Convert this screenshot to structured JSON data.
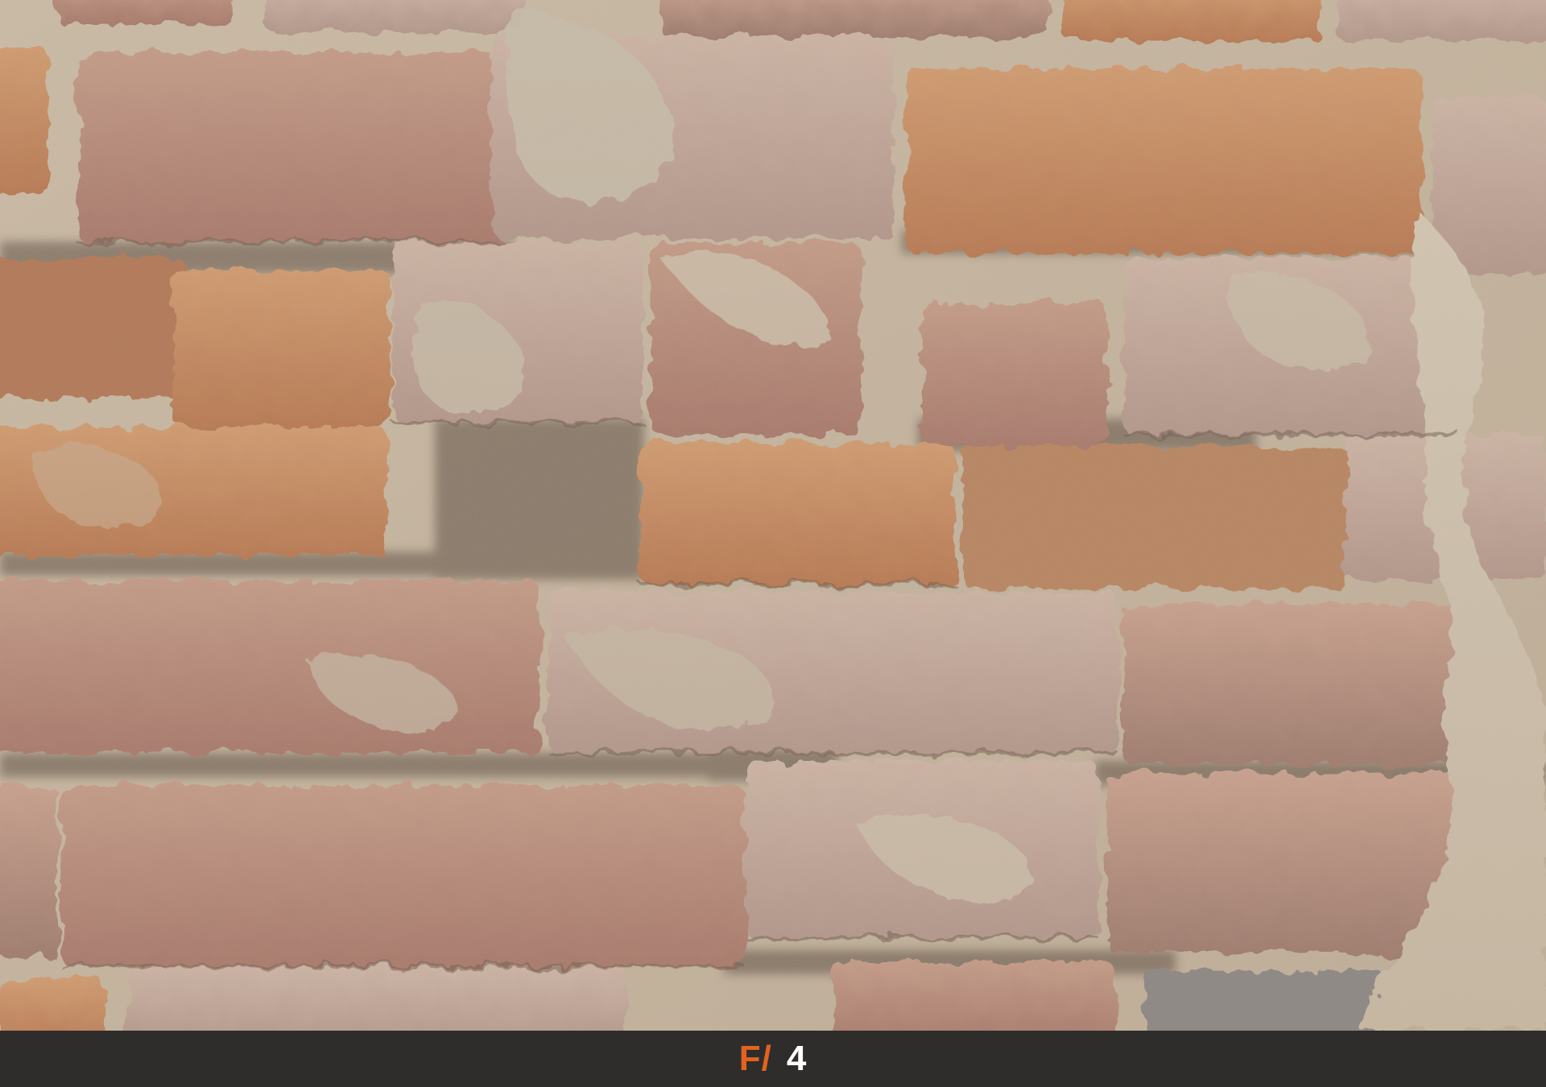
{
  "caption": {
    "prefix": "F/",
    "value": "4",
    "prefix_color": "#e2631f",
    "value_color": "#ffffff",
    "bar_color": "#2e2d2c"
  },
  "photo": {
    "subject_icon": "brick-wall-photo"
  }
}
